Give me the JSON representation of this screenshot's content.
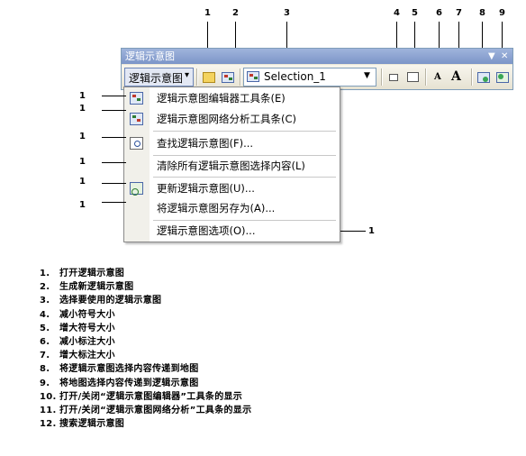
{
  "callouts": {
    "top": [
      "1",
      "2",
      "3",
      "4",
      "5",
      "6",
      "7",
      "8",
      "9"
    ],
    "left": [
      "1",
      "1",
      "1",
      "1",
      "1",
      "1"
    ],
    "right": "1"
  },
  "window": {
    "title": "逻辑示意图",
    "menu_arrow": "▼",
    "close": "✕"
  },
  "toolbar": {
    "diagram_menu_label": "逻辑示意图",
    "diagram_menu_arrow": "▾",
    "selection_value": "Selection_1",
    "selection_arrow": "▼",
    "icons": [
      "open-diagram-icon",
      "new-diagram-icon",
      "selection-icon",
      "reduce-symbol-icon",
      "enlarge-symbol-icon",
      "reduce-label-icon",
      "enlarge-label-icon",
      "transfer-to-map-icon",
      "transfer-to-diagram-icon"
    ]
  },
  "menu": {
    "items": [
      {
        "label": "逻辑示意图编辑器工具条(E)"
      },
      {
        "label": "逻辑示意图网络分析工具条(C)"
      },
      {
        "label": "查找逻辑示意图(F)..."
      },
      {
        "label": "清除所有逻辑示意图选择内容(L)"
      },
      {
        "label": "更新逻辑示意图(U)..."
      },
      {
        "label": "将逻辑示意图另存为(A)..."
      },
      {
        "label": "逻辑示意图选项(O)..."
      }
    ]
  },
  "legend": [
    {
      "num": "1.",
      "text": "打开逻辑示意图"
    },
    {
      "num": "2.",
      "text": "生成新逻辑示意图"
    },
    {
      "num": "3.",
      "text": "选择要使用的逻辑示意图"
    },
    {
      "num": "4.",
      "text": "减小符号大小"
    },
    {
      "num": "5.",
      "text": "增大符号大小"
    },
    {
      "num": "6.",
      "text": "减小标注大小"
    },
    {
      "num": "7.",
      "text": "增大标注大小"
    },
    {
      "num": "8.",
      "text": "将逻辑示意图选择内容传递到地图"
    },
    {
      "num": "9.",
      "text": "将地图选择内容传递到逻辑示意图"
    },
    {
      "num": "10.",
      "text": "打开/关闭“逻辑示意图编辑器”工具条的显示"
    },
    {
      "num": "11.",
      "text": "打开/关闭“逻辑示意图网络分析”工具条的显示"
    },
    {
      "num": "12.",
      "text": "搜索逻辑示意图"
    }
  ]
}
